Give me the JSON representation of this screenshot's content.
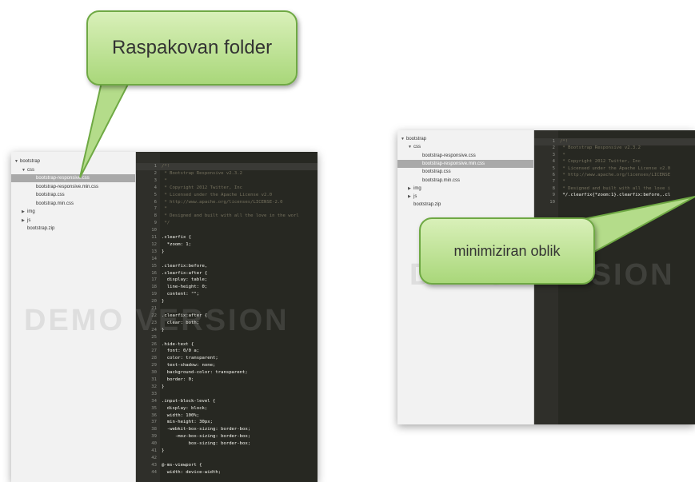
{
  "callouts": {
    "folder_label": "Raspakovan folder",
    "minified_label": "minimiziran oblik"
  },
  "watermark": "DEMO VERSION",
  "left_panel": {
    "tree": [
      {
        "label": "bootstrap",
        "arrow": "▼",
        "level": 0,
        "selected": false
      },
      {
        "label": "css",
        "arrow": "▼",
        "level": 1,
        "selected": false
      },
      {
        "label": "bootstrap-responsive.css",
        "arrow": "",
        "level": 2,
        "selected": true
      },
      {
        "label": "bootstrap-responsive.min.css",
        "arrow": "",
        "level": 2,
        "selected": false
      },
      {
        "label": "bootstrap.css",
        "arrow": "",
        "level": 2,
        "selected": false
      },
      {
        "label": "bootstrap.min.css",
        "arrow": "",
        "level": 2,
        "selected": false
      },
      {
        "label": "img",
        "arrow": "▶",
        "level": 1,
        "selected": false
      },
      {
        "label": "js",
        "arrow": "▶",
        "level": 1,
        "selected": false
      },
      {
        "label": "bootstrap.zip",
        "arrow": "",
        "level": 1,
        "selected": false
      }
    ],
    "code": [
      {
        "n": "1",
        "t": "/*!",
        "c": true
      },
      {
        "n": "2",
        "t": " * Bootstrap Responsive v2.3.2",
        "c": true
      },
      {
        "n": "3",
        "t": " *",
        "c": true
      },
      {
        "n": "4",
        "t": " * Copyright 2012 Twitter, Inc",
        "c": true
      },
      {
        "n": "5",
        "t": " * Licensed under the Apache License v2.0",
        "c": true
      },
      {
        "n": "6",
        "t": " * http://www.apache.org/licenses/LICENSE-2.0",
        "c": true
      },
      {
        "n": "7",
        "t": " *",
        "c": true
      },
      {
        "n": "8",
        "t": " * Designed and built with all the love in the worl",
        "c": true
      },
      {
        "n": "9",
        "t": " */",
        "c": true
      },
      {
        "n": "10",
        "t": "",
        "c": false
      },
      {
        "n": "11",
        "t": ".clearfix {",
        "c": false
      },
      {
        "n": "12",
        "t": "  *zoom: 1;",
        "c": false
      },
      {
        "n": "13",
        "t": "}",
        "c": false
      },
      {
        "n": "14",
        "t": "",
        "c": false
      },
      {
        "n": "15",
        "t": ".clearfix:before,",
        "c": false
      },
      {
        "n": "16",
        "t": ".clearfix:after {",
        "c": false
      },
      {
        "n": "17",
        "t": "  display: table;",
        "c": false
      },
      {
        "n": "18",
        "t": "  line-height: 0;",
        "c": false
      },
      {
        "n": "19",
        "t": "  content: \"\";",
        "c": false
      },
      {
        "n": "20",
        "t": "}",
        "c": false
      },
      {
        "n": "21",
        "t": "",
        "c": false
      },
      {
        "n": "22",
        "t": ".clearfix:after {",
        "c": false
      },
      {
        "n": "23",
        "t": "  clear: both;",
        "c": false
      },
      {
        "n": "24",
        "t": "}",
        "c": false
      },
      {
        "n": "25",
        "t": "",
        "c": false
      },
      {
        "n": "26",
        "t": ".hide-text {",
        "c": false
      },
      {
        "n": "27",
        "t": "  font: 0/0 a;",
        "c": false
      },
      {
        "n": "28",
        "t": "  color: transparent;",
        "c": false
      },
      {
        "n": "29",
        "t": "  text-shadow: none;",
        "c": false
      },
      {
        "n": "30",
        "t": "  background-color: transparent;",
        "c": false
      },
      {
        "n": "31",
        "t": "  border: 0;",
        "c": false
      },
      {
        "n": "32",
        "t": "}",
        "c": false
      },
      {
        "n": "33",
        "t": "",
        "c": false
      },
      {
        "n": "34",
        "t": ".input-block-level {",
        "c": false
      },
      {
        "n": "35",
        "t": "  display: block;",
        "c": false
      },
      {
        "n": "36",
        "t": "  width: 100%;",
        "c": false
      },
      {
        "n": "37",
        "t": "  min-height: 30px;",
        "c": false
      },
      {
        "n": "38",
        "t": "  -webkit-box-sizing: border-box;",
        "c": false
      },
      {
        "n": "39",
        "t": "     -moz-box-sizing: border-box;",
        "c": false
      },
      {
        "n": "40",
        "t": "          box-sizing: border-box;",
        "c": false
      },
      {
        "n": "41",
        "t": "}",
        "c": false
      },
      {
        "n": "42",
        "t": "",
        "c": false
      },
      {
        "n": "43",
        "t": "@-ms-viewport {",
        "c": false
      },
      {
        "n": "44",
        "t": "  width: device-width;",
        "c": false
      }
    ]
  },
  "right_panel": {
    "tree": [
      {
        "label": "bootstrap",
        "arrow": "▼",
        "level": 0,
        "selected": false
      },
      {
        "label": "css",
        "arrow": "▼",
        "level": 1,
        "selected": false
      },
      {
        "label": "bootstrap-responsive.css",
        "arrow": "",
        "level": 2,
        "selected": false
      },
      {
        "label": "bootstrap-responsive.min.css",
        "arrow": "",
        "level": 2,
        "selected": true
      },
      {
        "label": "bootstrap.css",
        "arrow": "",
        "level": 2,
        "selected": false
      },
      {
        "label": "bootstrap.min.css",
        "arrow": "",
        "level": 2,
        "selected": false
      },
      {
        "label": "img",
        "arrow": "▶",
        "level": 1,
        "selected": false
      },
      {
        "label": "js",
        "arrow": "▶",
        "level": 1,
        "selected": false
      },
      {
        "label": "bootstrap.zip",
        "arrow": "",
        "level": 1,
        "selected": false
      }
    ],
    "code": [
      {
        "n": "1",
        "t": "/*!",
        "c": true
      },
      {
        "n": "2",
        "t": " * Bootstrap Responsive v2.3.2",
        "c": true
      },
      {
        "n": "3",
        "t": " *",
        "c": true
      },
      {
        "n": "4",
        "t": " * Copyright 2012 Twitter, Inc",
        "c": true
      },
      {
        "n": "5",
        "t": " * Licensed under the Apache License v2.0",
        "c": true
      },
      {
        "n": "6",
        "t": " * http://www.apache.org/licenses/LICENSE",
        "c": true
      },
      {
        "n": "7",
        "t": " *",
        "c": true
      },
      {
        "n": "8",
        "t": " * Designed and built with all the love i",
        "c": true
      },
      {
        "n": "9",
        "t": " */.clearfix{*zoom:1}.clearfix:before,.cl",
        "c": false
      },
      {
        "n": "10",
        "t": "",
        "c": false
      }
    ]
  }
}
